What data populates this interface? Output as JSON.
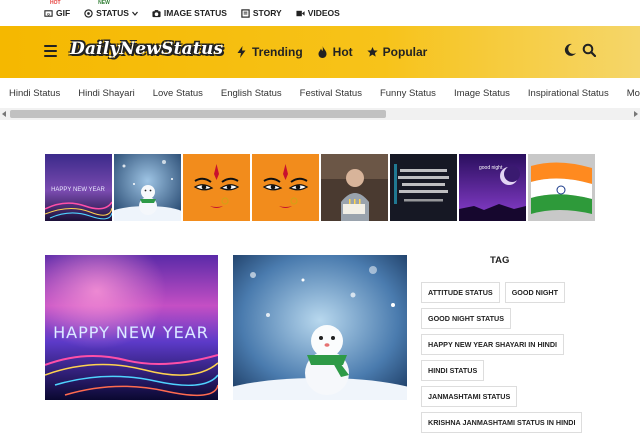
{
  "topbar": {
    "items": [
      {
        "label": "GIF",
        "badge": "HOT",
        "icon": "gif-icon"
      },
      {
        "label": "STATUS",
        "badge": "NEW",
        "icon": "whatsapp-icon"
      },
      {
        "label": "IMAGE STATUS",
        "badge": "",
        "icon": "camera-icon"
      },
      {
        "label": "STORY",
        "badge": "",
        "icon": "book-icon"
      },
      {
        "label": "VIDEOS",
        "badge": "",
        "icon": "video-icon"
      }
    ]
  },
  "header": {
    "logo": "DailyNewStatus",
    "nav": [
      {
        "label": "Trending",
        "icon": "bolt-icon"
      },
      {
        "label": "Hot",
        "icon": "fire-icon"
      },
      {
        "label": "Popular",
        "icon": "star-icon"
      }
    ],
    "colors": {
      "accent": "#f5b800"
    }
  },
  "categories": [
    "Hindi Status",
    "Hindi Shayari",
    "Love Status",
    "English Status",
    "Festival Status",
    "Funny Status",
    "Image Status",
    "Inspirational Status",
    "Motivation Status"
  ],
  "thumbnails": {
    "captions": {
      "happy_new_year": "HAPPY NEW YEAR",
      "good_night": "good night"
    }
  },
  "big_images": {
    "caption1": "HAPPY NEW YEAR"
  },
  "tags": {
    "title": "TAG",
    "items": [
      "ATTITUDE STATUS",
      "GOOD NIGHT",
      "GOOD NIGHT STATUS",
      "HAPPY NEW YEAR SHAYARI IN HINDI",
      "HINDI STATUS",
      "JANMASHTAMI STATUS",
      "KRISHNA JANMASHTAMI STATUS IN HINDI"
    ]
  }
}
